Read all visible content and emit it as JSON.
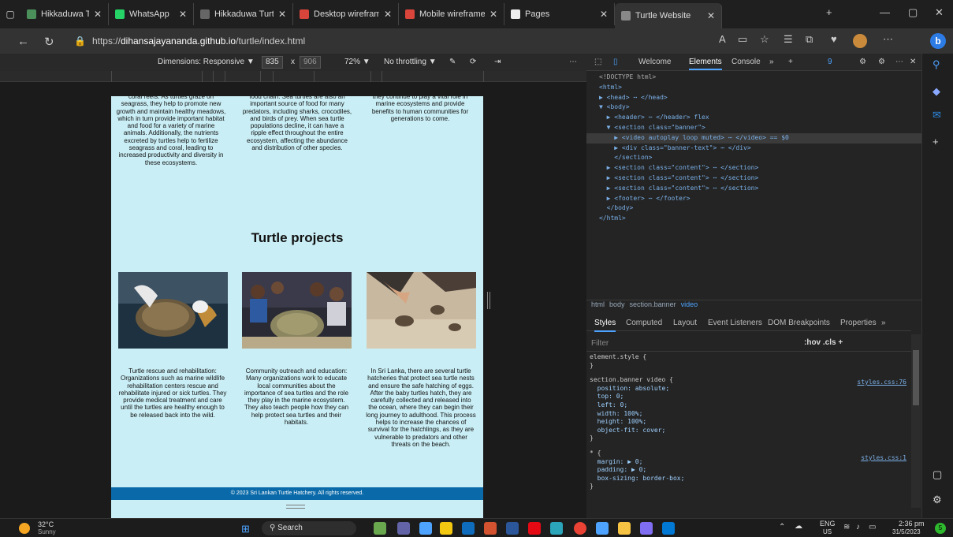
{
  "browser": {
    "tabs": [
      {
        "label": "Hikkaduwa Turtle Con",
        "color": "#4b8f5a"
      },
      {
        "label": "WhatsApp",
        "color": "#25d366"
      },
      {
        "label": "Hikkaduwa Turtle Hat",
        "color": "#666666"
      },
      {
        "label": "Desktop wireframe.pc",
        "color": "#d9453b"
      },
      {
        "label": "Mobile wireframe.pdf",
        "color": "#d9453b"
      },
      {
        "label": "Pages",
        "color": "#eeeeee"
      },
      {
        "label": "Turtle Website",
        "color": "#888888"
      }
    ],
    "url_prefix": "https://",
    "url_host": "dihansajayananda.github.io",
    "url_path": "/turtle/index.html"
  },
  "device_toolbar": {
    "dimensions_label": "Dimensions: Responsive ▼",
    "width": "835",
    "times": "x",
    "height": "906",
    "zoom": "72% ▼",
    "throttling": "No throttling ▼",
    "more": "⋯"
  },
  "page": {
    "col1_text": "coral reefs. As turtles graze on seagrass, they help to promote new growth and maintain healthy meadows, which in turn provide important habitat and food for a variety of marine animals. Additionally, the nutrients excreted by turtles help to fertilize seagrass and coral, leading to increased productivity and diversity in these ecosystems.",
    "col2_text": "food chain. Sea turtles are also an important source of food for many predators, including sharks, crocodiles, and birds of prey. When sea turtle populations decline, it can have a ripple effect throughout the entire ecosystem, affecting the abundance and distribution of other species.",
    "col3_text": "they continue to play a vital role in marine ecosystems and provide benefits to human communities for generations to come.",
    "heading": "Turtle projects",
    "project1": "Turtle rescue and rehabilitation: Organizations such as marine wildlife rehabilitation centers rescue and rehabilitate injured or sick turtles. They provide medical treatment and care until the turtles are healthy enough to be released back into the wild.",
    "project2": "Community outreach and education: Many organizations work to educate local communities about the importance of sea turtles and the role they play in the marine ecosystem. They also teach people how they can help protect sea turtles and their habitats.",
    "project3": "In Sri Lanka, there are several turtle hatcheries that protect sea turtle nests and ensure the safe hatching of eggs. After the baby turtles hatch, they are carefully collected and released into the ocean, where they can begin their long journey to adulthood. This process helps to increase the chances of survival for the hatchlings, as they are vulnerable to predators and other threats on the beach.",
    "footer": "© 2023 Sri Lankan Turtle Hatchery. All rights reserved."
  },
  "devtools": {
    "tabs": [
      "Welcome",
      "Elements",
      "Console",
      "»",
      "+"
    ],
    "issues_count": "9",
    "dom_lines": [
      "<!DOCTYPE html>",
      "<html>",
      "▶ <head> ⋯ </head>",
      "▼ <body>",
      "  ▶ <header> ⋯ </header> flex",
      "  ▼ <section class=\"banner\">",
      "    ▶ <video autoplay loop muted> ⋯ </video> == $0",
      "    ▶ <div class=\"banner-text\"> ⋯ </div>",
      "    </section>",
      "  ▶ <section class=\"content\"> ⋯ </section>",
      "  ▶ <section class=\"content\"> ⋯ </section>",
      "  ▶ <section class=\"content\"> ⋯ </section>",
      "  ▶ <footer> ⋯ </footer>",
      "  </body>",
      "</html>"
    ],
    "breadcrumbs": [
      "html",
      "body",
      "section.banner",
      "video"
    ],
    "style_tabs": [
      "Styles",
      "Computed",
      "Layout",
      "Event Listeners",
      "DOM Breakpoints",
      "Properties",
      "»"
    ],
    "filter_placeholder": "Filter",
    "filter_tools": ":hov  .cls  +",
    "style_rules": [
      "element.style {",
      "}",
      "section.banner video {",
      "  position: absolute;",
      "  top: 0;",
      "  left: 0;",
      "  width: 100%;",
      "  height: 100%;",
      "  object-fit: cover;",
      "}",
      "* {",
      "  margin: ▶ 0;",
      "  padding: ▶ 0;",
      "  box-sizing: border-box;",
      "}"
    ],
    "src1": "styles.css:76",
    "src2": "styles.css:1"
  },
  "taskbar": {
    "temp": "32°C",
    "weather": "Sunny",
    "search": "Search",
    "lang1": "ENG",
    "lang2": "US",
    "time": "2:36 pm",
    "date": "31/5/2023"
  }
}
